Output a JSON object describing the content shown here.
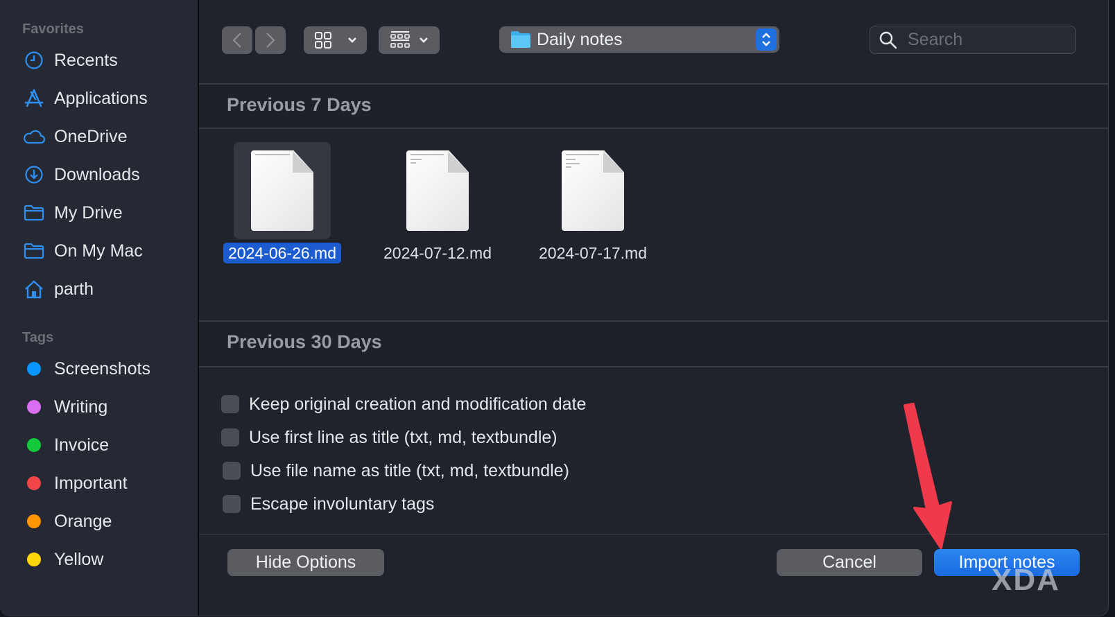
{
  "sidebar": {
    "favorites_label": "Favorites",
    "favorites": [
      {
        "label": "Recents",
        "icon": "clock-icon"
      },
      {
        "label": "Applications",
        "icon": "applications-icon"
      },
      {
        "label": "OneDrive",
        "icon": "cloud-icon"
      },
      {
        "label": "Downloads",
        "icon": "download-icon"
      },
      {
        "label": "My Drive",
        "icon": "folder-icon"
      },
      {
        "label": "On My Mac",
        "icon": "folder-icon"
      },
      {
        "label": "parth",
        "icon": "home-icon"
      }
    ],
    "tags_label": "Tags",
    "tags": [
      {
        "label": "Screenshots",
        "color": "#0a95ff"
      },
      {
        "label": "Writing",
        "color": "#d96ef0"
      },
      {
        "label": "Invoice",
        "color": "#14c93c"
      },
      {
        "label": "Important",
        "color": "#f0464a"
      },
      {
        "label": "Orange",
        "color": "#ff9500"
      },
      {
        "label": "Yellow",
        "color": "#ffd60a"
      }
    ]
  },
  "toolbar": {
    "back_icon": "chevron-left-icon",
    "forward_icon": "chevron-right-icon",
    "view_icon": "icon-grid-view-icon",
    "group_icon": "group-by-icon",
    "location": "Daily notes",
    "search_placeholder": "Search",
    "search_value": ""
  },
  "groups": [
    {
      "title": "Previous 7 Days",
      "files": [
        {
          "name": "2024-06-26.md",
          "selected": true
        },
        {
          "name": "2024-07-12.md",
          "selected": false
        },
        {
          "name": "2024-07-17.md",
          "selected": false
        }
      ]
    },
    {
      "title": "Previous 30 Days",
      "files": []
    }
  ],
  "options": [
    {
      "label": "Keep original creation and modification date",
      "checked": false
    },
    {
      "label": "Use first line as title (txt, md, textbundle)",
      "checked": false
    },
    {
      "label": "Use file name as title (txt, md, textbundle)",
      "checked": false
    },
    {
      "label": "Escape involuntary tags",
      "checked": false
    }
  ],
  "footer": {
    "hide_options": "Hide Options",
    "cancel": "Cancel",
    "import": "Import notes"
  },
  "colors": {
    "accent": "#1a6ae0",
    "annotation_arrow": "#f0394a"
  },
  "watermark": "XDA"
}
